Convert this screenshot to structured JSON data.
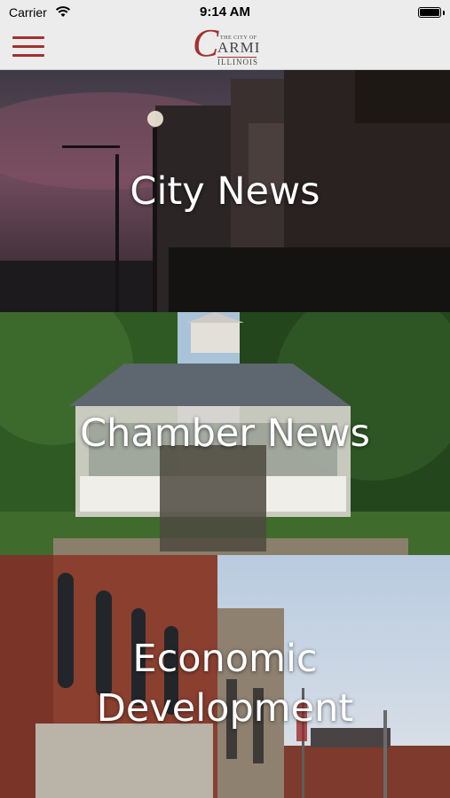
{
  "status_bar": {
    "carrier": "Carrier",
    "time": "9:14 AM"
  },
  "header": {
    "logo": {
      "letter": "C",
      "small_text": "THE CITY OF",
      "main_text": "ARMI",
      "sub_text": "ILLINOIS"
    }
  },
  "tiles": [
    {
      "label": "City News"
    },
    {
      "label": "Chamber News"
    },
    {
      "label": "Economic Development"
    }
  ],
  "colors": {
    "accent": "#a3302f",
    "bar_bg": "#ececec"
  },
  "icons": {
    "menu": "hamburger-menu-icon",
    "wifi": "wifi-icon",
    "battery": "battery-icon"
  }
}
